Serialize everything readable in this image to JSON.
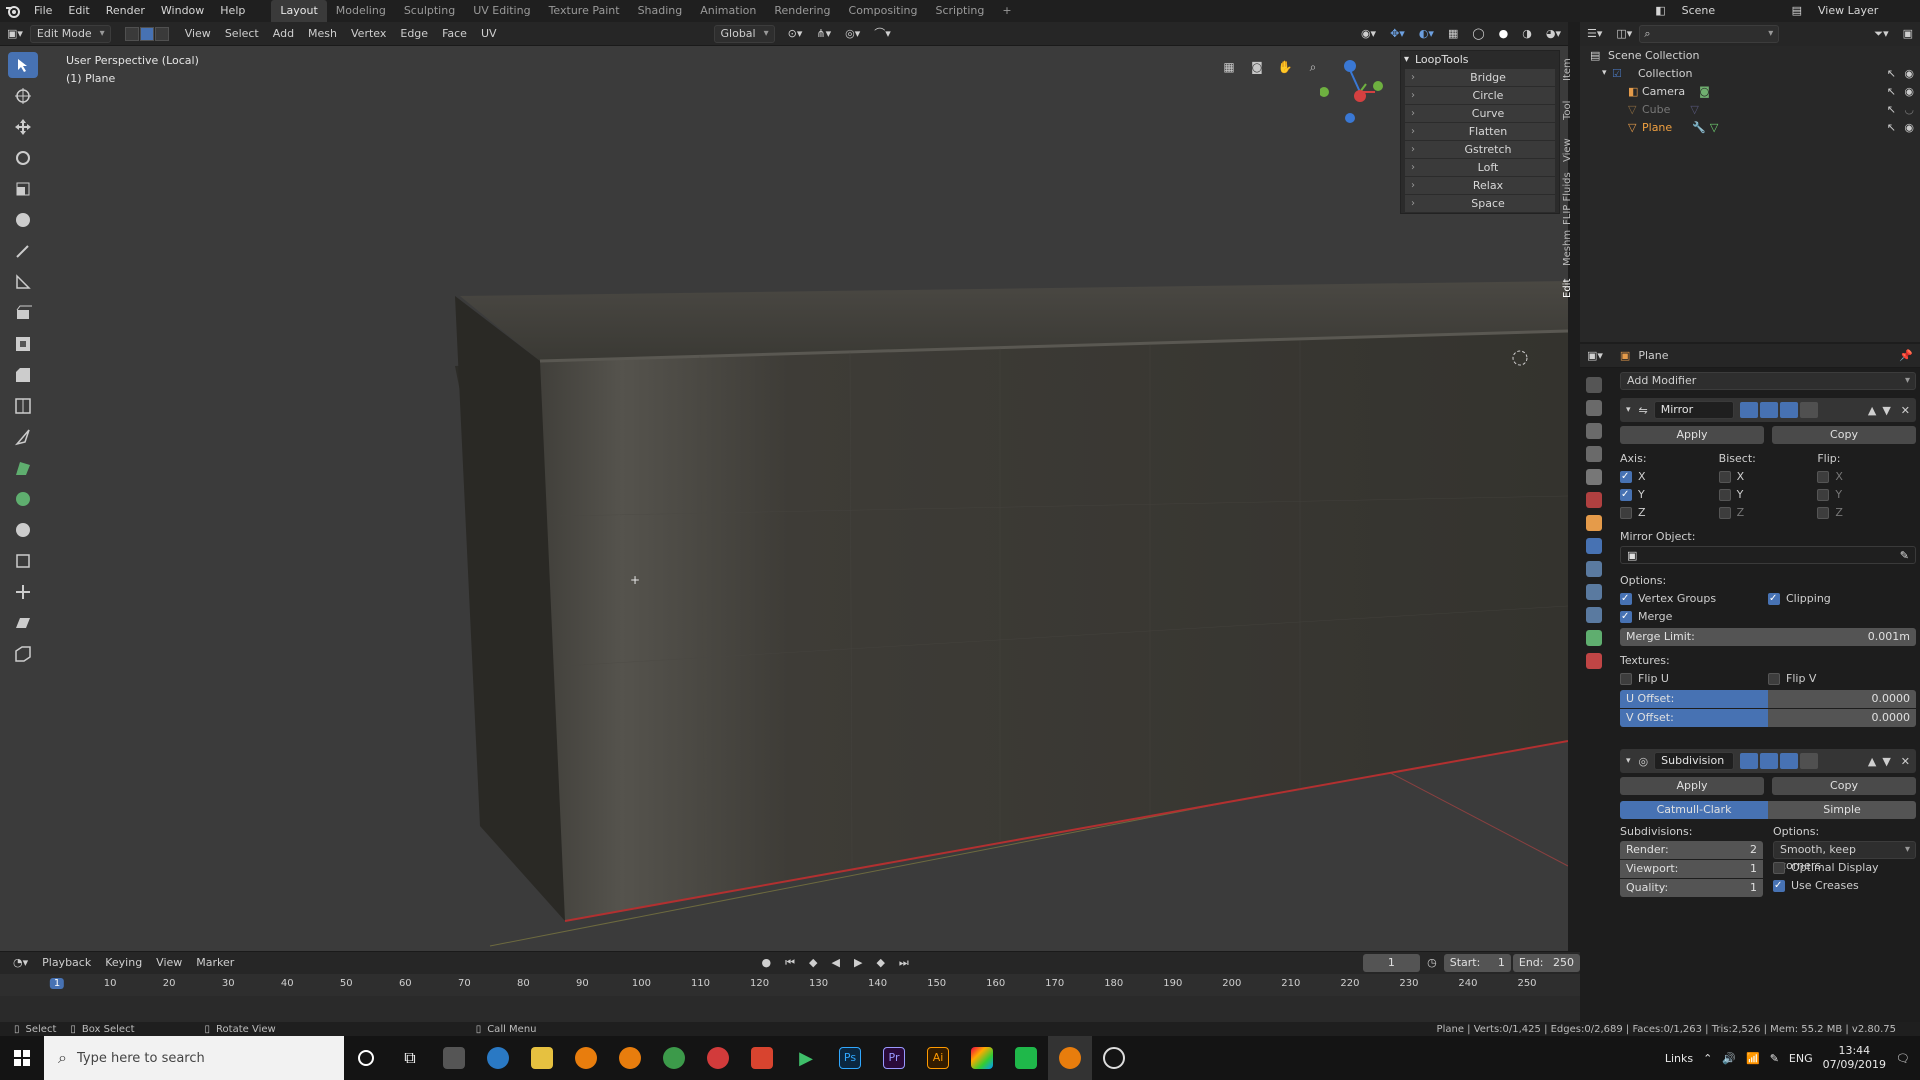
{
  "app": {
    "title": "Blender"
  },
  "menus": [
    "File",
    "Edit",
    "Render",
    "Window",
    "Help"
  ],
  "workspaces": [
    "Layout",
    "Modeling",
    "Sculpting",
    "UV Editing",
    "Texture Paint",
    "Shading",
    "Animation",
    "Rendering",
    "Compositing",
    "Scripting"
  ],
  "active_workspace": "Layout",
  "scene": {
    "label": "Scene",
    "view_layer": "View Layer"
  },
  "header": {
    "mode": "Edit Mode",
    "menus": [
      "View",
      "Select",
      "Add",
      "Mesh",
      "Vertex",
      "Edge",
      "Face",
      "UV"
    ],
    "transform": "Global"
  },
  "viewport": {
    "perspective": "User Perspective (Local)",
    "object": "(1) Plane"
  },
  "looptools": {
    "title": "LoopTools",
    "items": [
      "Bridge",
      "Circle",
      "Curve",
      "Flatten",
      "Gstretch",
      "Loft",
      "Relax",
      "Space"
    ]
  },
  "sidetabs": [
    "Item",
    "Tool",
    "View",
    "FLIP Fluids",
    "Meshm",
    "Edit"
  ],
  "outliner": {
    "root": "Scene Collection",
    "items": [
      {
        "name": "Collection"
      },
      {
        "name": "Camera"
      },
      {
        "name": "Cube"
      },
      {
        "name": "Plane"
      }
    ]
  },
  "properties": {
    "object": "Plane",
    "add_modifier": "Add Modifier",
    "mirror": {
      "name": "Mirror",
      "apply": "Apply",
      "copy": "Copy",
      "axis_label": "Axis:",
      "bisect_label": "Bisect:",
      "flip_label": "Flip:",
      "axes": [
        "X",
        "Y",
        "Z"
      ],
      "mirror_object_label": "Mirror Object:",
      "options_label": "Options:",
      "vertex_groups": "Vertex Groups",
      "clipping": "Clipping",
      "merge": "Merge",
      "merge_limit_label": "Merge Limit:",
      "merge_limit": "0.001m",
      "textures_label": "Textures:",
      "flip_u": "Flip U",
      "flip_v": "Flip V",
      "u_offset_label": "U Offset:",
      "u_offset": "0.0000",
      "v_offset_label": "V Offset:",
      "v_offset": "0.0000"
    },
    "subdivision": {
      "name": "Subdivision",
      "apply": "Apply",
      "copy": "Copy",
      "catmull": "Catmull-Clark",
      "simple": "Simple",
      "subdivisions_label": "Subdivisions:",
      "options_label": "Options:",
      "render_label": "Render:",
      "render": "2",
      "viewport_label": "Viewport:",
      "viewport": "1",
      "quality_label": "Quality:",
      "quality": "1",
      "uv_smooth": "Smooth, keep corners",
      "optimal_display": "Optimal Display",
      "use_creases": "Use Creases"
    }
  },
  "timeline": {
    "menus": [
      "Playback",
      "Keying",
      "View",
      "Marker"
    ],
    "current_frame": "1",
    "start_label": "Start:",
    "start": "1",
    "end_label": "End:",
    "end": "250",
    "ticks": [
      "1",
      "10",
      "20",
      "30",
      "40",
      "50",
      "60",
      "70",
      "80",
      "90",
      "100",
      "110",
      "120",
      "130",
      "140",
      "150",
      "160",
      "170",
      "180",
      "190",
      "200",
      "210",
      "220",
      "230",
      "240",
      "250"
    ]
  },
  "status": {
    "select": "Select",
    "box_select": "Box Select",
    "rotate": "Rotate View",
    "call_menu": "Call Menu",
    "stats": "Plane | Verts:0/1,425 | Edges:0/2,689 | Faces:0/1,263 | Tris:2,526 | Mem: 55.2 MB | v2.80.75"
  },
  "taskbar": {
    "search_placeholder": "Type here to search",
    "tray_links": "Links",
    "lang": "ENG",
    "time": "13:44",
    "date": "07/09/2019"
  },
  "colors": {
    "accent": "#4772b3",
    "background": "#3c3c3c",
    "panel": "#2a2a2a"
  }
}
